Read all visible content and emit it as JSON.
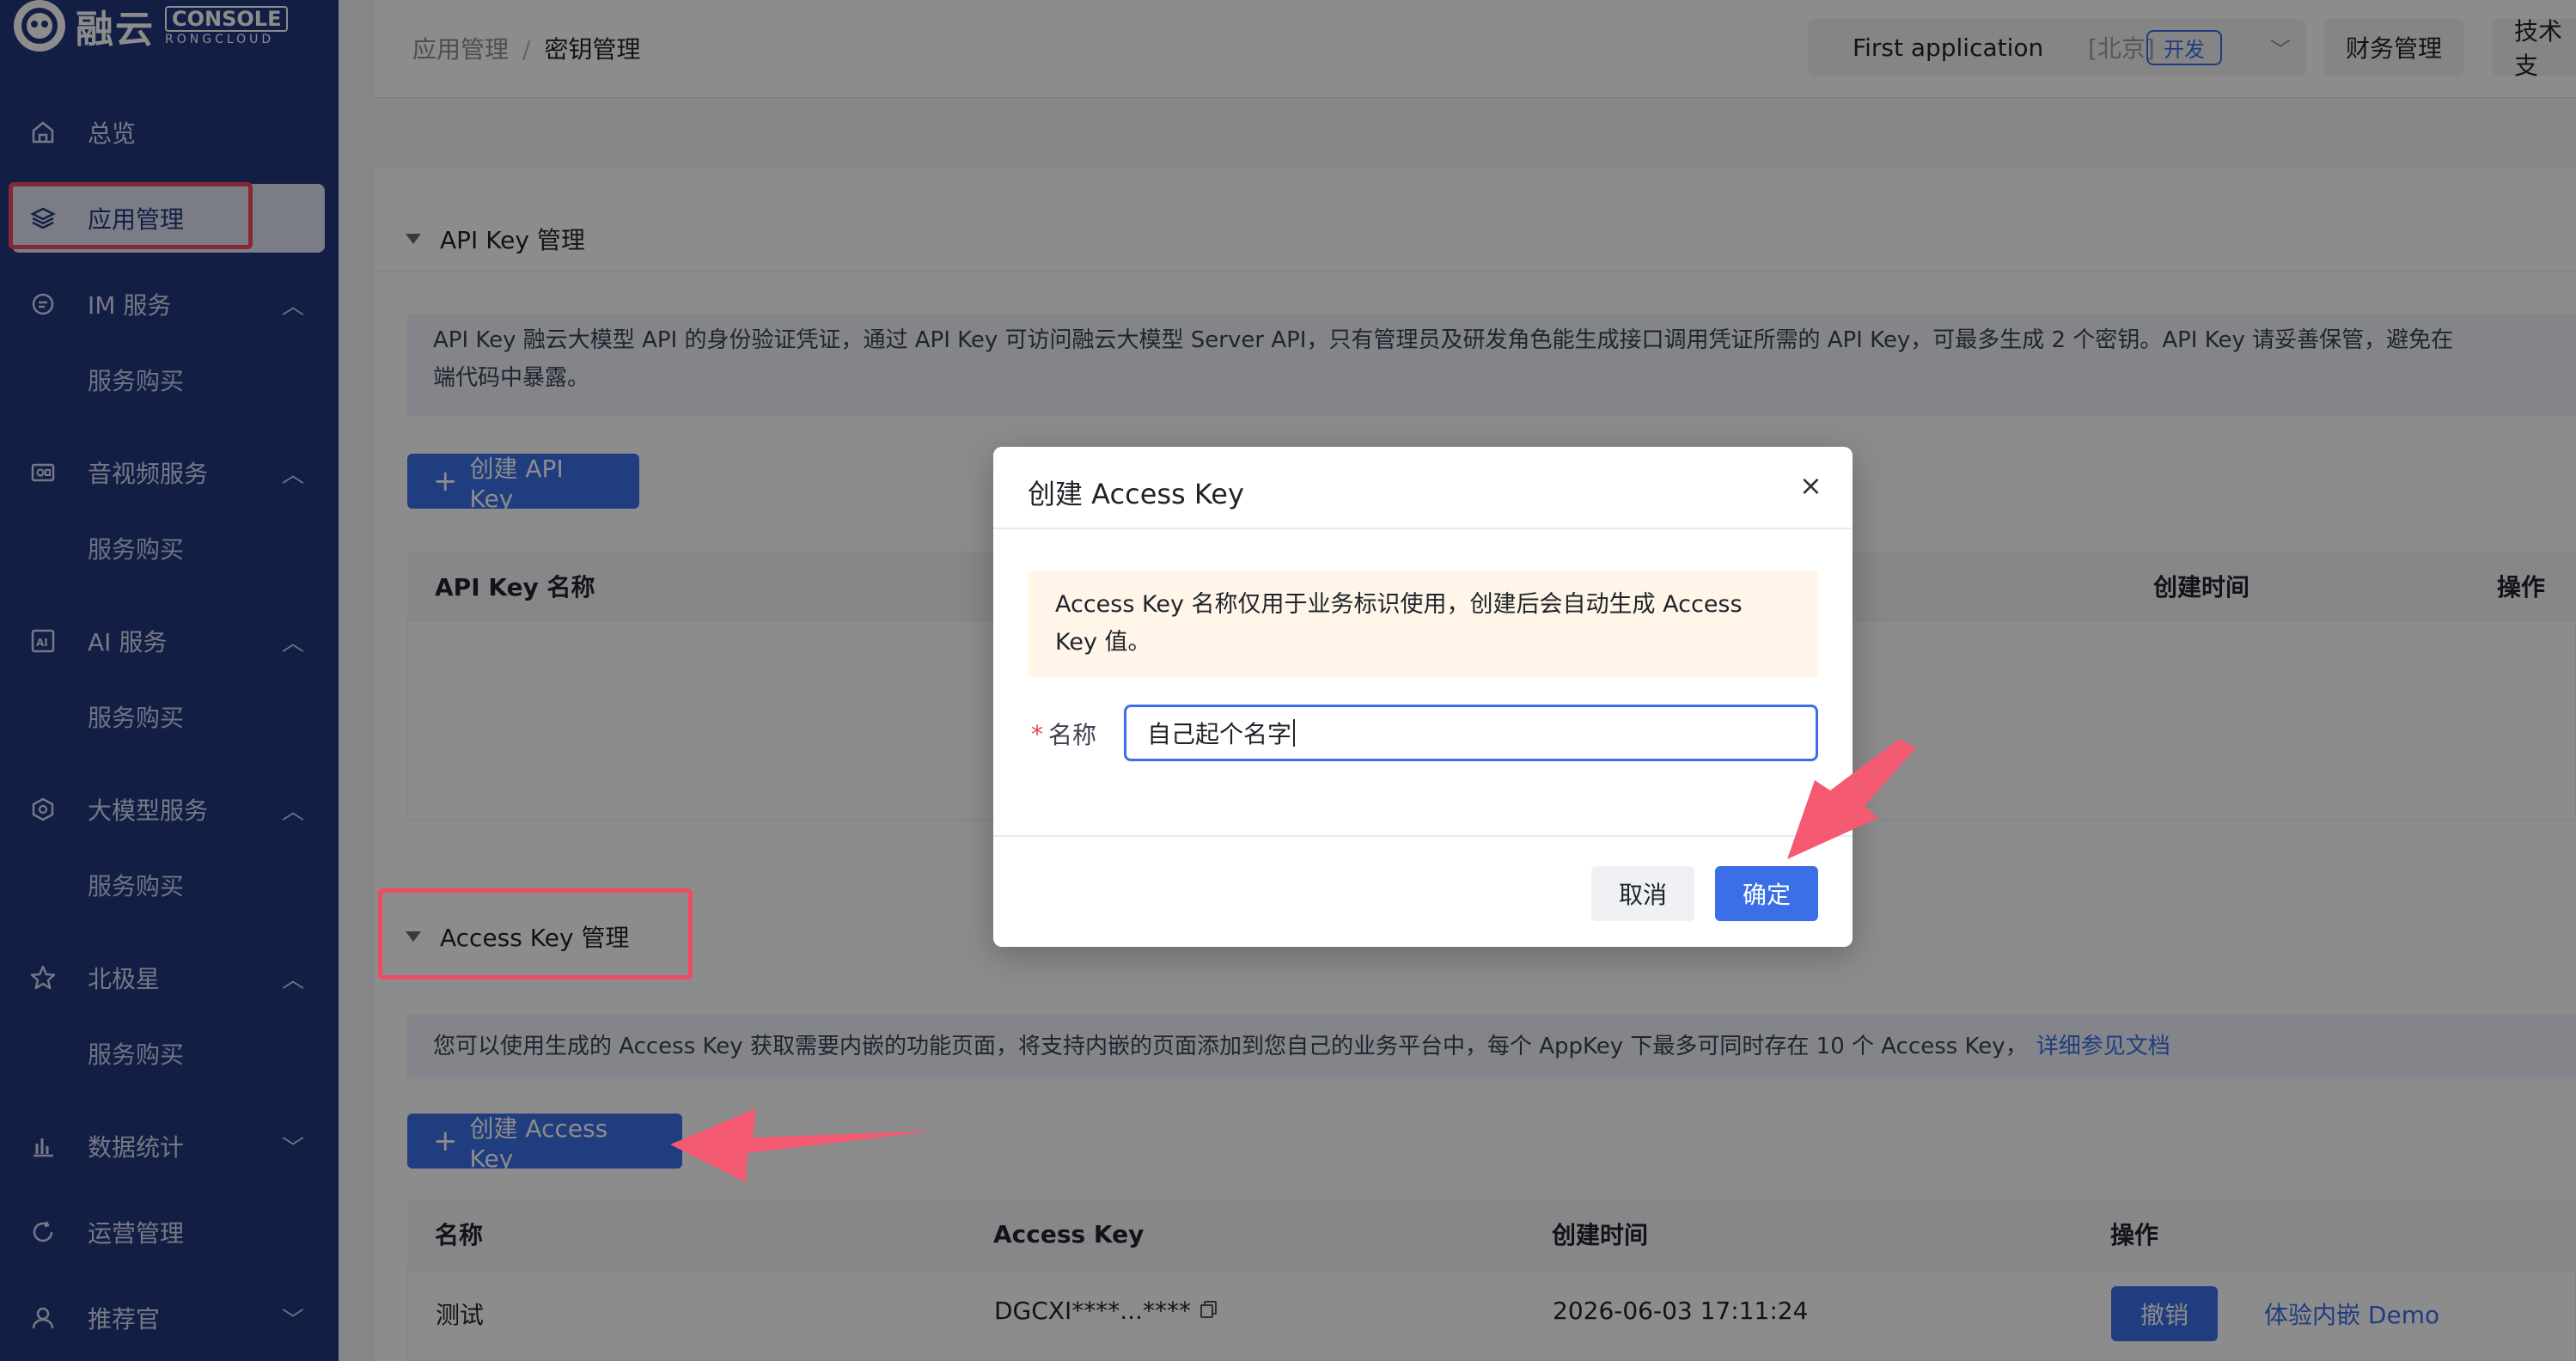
{
  "sidebar": {
    "logo_text": "融云",
    "logo_console": "CONSOLE",
    "logo_sub": "RONGCLOUD",
    "items": [
      {
        "label": "总览",
        "icon": "home-icon"
      },
      {
        "label": "应用管理",
        "icon": "layers-icon",
        "active": true
      },
      {
        "label": "IM 服务",
        "icon": "chat-icon",
        "sub": "服务购买"
      },
      {
        "label": "音视频服务",
        "icon": "video-icon",
        "sub": "服务购买"
      },
      {
        "label": "AI 服务",
        "icon": "ai-icon",
        "sub": "服务购买"
      },
      {
        "label": "大模型服务",
        "icon": "model-icon",
        "sub": "服务购买"
      },
      {
        "label": "北极星",
        "icon": "star-icon",
        "sub": "服务购买"
      },
      {
        "label": "数据统计",
        "icon": "bar-chart-icon"
      },
      {
        "label": "运营管理",
        "icon": "refresh-icon"
      },
      {
        "label": "推荐官",
        "icon": "user-icon"
      }
    ]
  },
  "header": {
    "breadcrumb_parent": "应用管理",
    "breadcrumb_sep": "/",
    "breadcrumb_current": "密钥管理",
    "app_name": "First application",
    "app_region": "[北京]",
    "app_env": "开发",
    "finance_label": "财务管理",
    "tech_label": "技术支"
  },
  "api_key_section": {
    "title": "API Key 管理",
    "info_line1": "API Key 融云大模型 API 的身份验证凭证，通过 API Key 可访问融云大模型 Server API，只有管理员及研发角色能生成接口调用凭证所需的 API Key，可最多生成 2 个密钥。API Key 请妥善保管，避免在",
    "info_line2": "端代码中暴露。",
    "create_button": "创建 API Key",
    "columns": [
      "API Key 名称",
      "创建时间",
      "操作"
    ]
  },
  "access_key_section": {
    "title": "Access Key 管理",
    "info": "您可以使用生成的 Access Key 获取需要内嵌的功能页面，将支持内嵌的页面添加到您自己的业务平台中，每个 AppKey 下最多可同时存在 10 个 Access Key，",
    "info_link": "详细参见文档",
    "create_button": "创建 Access Key",
    "columns": [
      "名称",
      "Access Key",
      "创建时间",
      "操作"
    ],
    "rows": [
      {
        "name": "测试",
        "key": "DGCXI****...****",
        "created": "2026-06-03 17:11:24",
        "revoke": "撤销",
        "demo": "体验内嵌 Demo"
      }
    ]
  },
  "modal": {
    "title": "创建 Access Key",
    "close": "×",
    "notice_line1": "Access Key 名称仅用于业务标识使用，创建后会自动生成 Access",
    "notice_line2": "Key 值。",
    "required_mark": "*",
    "name_label": "名称",
    "name_value": "自己起个名字",
    "cancel": "取消",
    "ok": "确定"
  },
  "colors": {
    "sidebar_bg": "#24387f",
    "primary": "#3a6fe8",
    "highlight_red": "#f04a63"
  }
}
